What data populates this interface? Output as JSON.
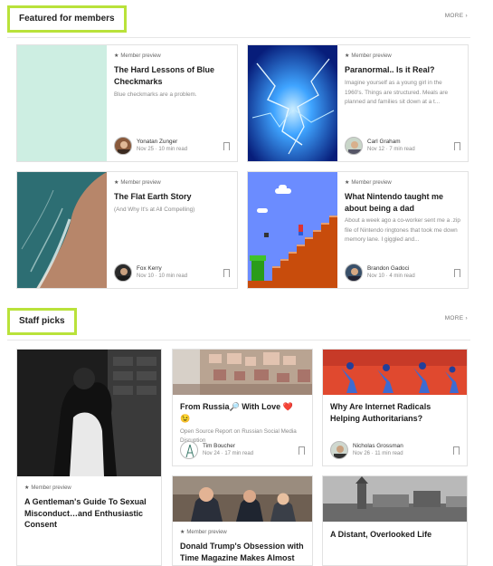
{
  "featured": {
    "title": "Featured for members",
    "more": "MORE",
    "more_icon": "chevron-right-icon",
    "cards": [
      {
        "preview": "Member preview",
        "title": "The Hard Lessons of Blue Checkmarks",
        "subtitle": "Blue checkmarks are a problem.",
        "author": "Yonatan Zunger",
        "meta": "Nov 25 · 10 min read"
      },
      {
        "preview": "Member preview",
        "title": "Paranormal.. Is it Real?",
        "subtitle": "Imagine yourself as a young girl in the 1960's. Things are structured. Meals are planned and families sit down at a t...",
        "author": "Carl Graham",
        "meta": "Nov 12 · 7 min read"
      },
      {
        "preview": "Member preview",
        "title": "The Flat Earth Story",
        "subtitle": "(And Why It's at All Compelling)",
        "author": "Fox Kerry",
        "meta": "Nov 10 · 10 min read"
      },
      {
        "preview": "Member preview",
        "title": "What Nintendo taught me about being a dad",
        "subtitle": "About a week ago a co-worker sent me a .zip file of Nintendo ringtones that took me down memory lane. I giggled and...",
        "author": "Brandon Gadoci",
        "meta": "Nov 10 · 4 min read"
      }
    ]
  },
  "staff": {
    "title": "Staff picks",
    "more": "MORE",
    "more_icon": "chevron-right-icon",
    "big": {
      "preview": "Member preview",
      "title": "A Gentleman's Guide To Sexual Misconduct…and Enthusiastic Consent"
    },
    "cards": [
      {
        "title": "From Russia🔎 With Love ❤️ 😉",
        "subtitle": "Open Source Report on Russian Social Media Disruption",
        "author": "Tim Boucher",
        "meta": "Nov 24 · 17 min read"
      },
      {
        "title": "Why Are Internet Radicals Helping Authoritarians?",
        "author": "Nicholas Grossman",
        "meta": "Nov 26 · 11 min read"
      },
      {
        "preview": "Member preview",
        "title": "Donald Trump's Obsession with Time Magazine Makes Almost T…"
      },
      {
        "title": "A Distant, Overlooked Life"
      }
    ]
  },
  "colors": {
    "highlight": "#b9e23a",
    "mint": "#cdeee2"
  },
  "icons": {
    "member": "star-icon",
    "bookmark": "bookmark-icon"
  }
}
